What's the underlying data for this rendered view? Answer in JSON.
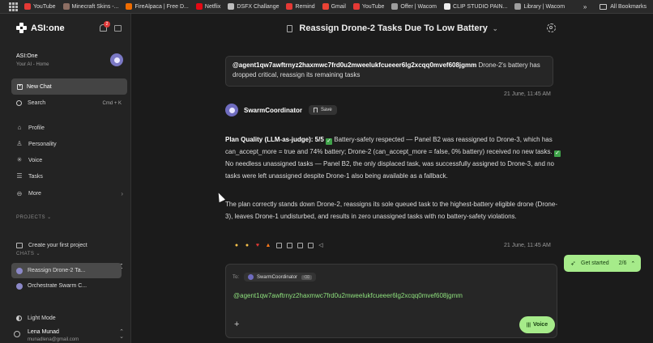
{
  "bookmarks_bar": {
    "items": [
      {
        "label": "YouTube",
        "color": "#e53935"
      },
      {
        "label": "Minecraft Skins -...",
        "color": "#8d6e63"
      },
      {
        "label": "FireAlpaca | Free D...",
        "color": "#ef6c00"
      },
      {
        "label": "Netflix",
        "color": "#e50914"
      },
      {
        "label": "DSFX Challange",
        "color": "#bdbdbd"
      },
      {
        "label": "Remind",
        "color": "#e53935"
      },
      {
        "label": "Gmail",
        "color": "#ea4335"
      },
      {
        "label": "YouTube",
        "color": "#e53935"
      },
      {
        "label": "Offer | Wacom",
        "color": "#9e9e9e"
      },
      {
        "label": "CLIP STUDIO PAIN...",
        "color": "#eeeeee"
      },
      {
        "label": "Library | Wacom",
        "color": "#9e9e9e"
      }
    ],
    "overflow": "»",
    "all_bookmarks": "All Bookmarks"
  },
  "sidebar": {
    "logo": "ASI:one",
    "notification_count": "2",
    "workspace_title": "ASI:One",
    "workspace_subtitle": "Your AI - Home",
    "new_chat": "New Chat",
    "search_label": "Search",
    "search_shortcut": "Cmd + K",
    "nav": [
      "Profile",
      "Personality",
      "Voice",
      "Tasks",
      "More"
    ],
    "projects_header": "PROJECTS",
    "create_project": "Create your first project",
    "chats_header": "CHATS",
    "chats": [
      "Reassign Drone-2 Ta...",
      "Orchestrate Swarm C..."
    ],
    "theme_toggle": "Light Mode",
    "user_name": "Lena Munad",
    "user_email": "munadlena@gmail.com"
  },
  "header": {
    "title": "Reassign Drone-2 Tasks Due To Low Battery"
  },
  "conversation": {
    "user_message_handle": "@agent1qw7awftrnyz2haxmwc7frd0u2mweelukfcueeer6lg2xcqq0mvef608jgmm",
    "user_message_text": "Drone-2's battery has dropped critical, reassign its remaining tasks",
    "user_timestamp": "21 June, 11:45 AM",
    "agent_name": "SwarmCoordinator",
    "save_label": "Save",
    "plan_quality_label": "Plan Quality (LLM-as-judge): 5/5",
    "para1_a": "Battery-safety respected — Panel B2 was reassigned to Drone-3, which has can_accept_more = true and 74% battery; Drone-2 (can_accept_more = false, 0% battery) received no new tasks.",
    "para1_b": "No needless unassigned tasks — Panel B2, the only displaced task, was successfully assigned to Drone-3, and no tasks were left unassigned despite Drone-1 also being available as a fallback.",
    "para2": "The plan correctly stands down Drone-2, reassigns its sole queued task to the highest-battery eligible drone (Drone-3), leaves Drone-1 undisturbed, and results in zero unassigned tasks with no battery-safety violations.",
    "agent_timestamp": "21 June, 11:45 AM"
  },
  "composer": {
    "to_label": "To:",
    "recipient": "SwarmCoordinator",
    "recipient_key": "⌫",
    "address": "@agent1qw7awftrnyz2haxmwc7frd0u2mweelukfcueeer6lg2xcqq0mvef608jgmm",
    "voice_label": "Voice"
  },
  "get_started": {
    "label": "Get started",
    "progress": "2/6"
  }
}
